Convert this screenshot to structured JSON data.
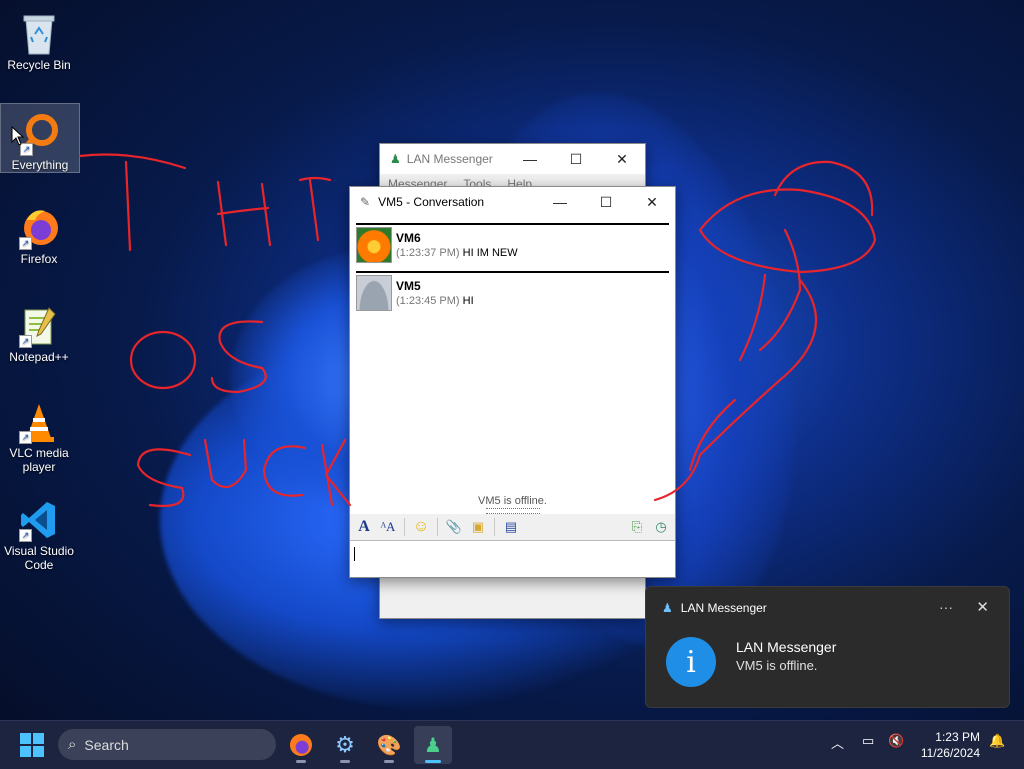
{
  "desktop": {
    "icons": [
      {
        "label": "Recycle Bin",
        "icon": "recycle-bin-icon"
      },
      {
        "label": "Everything",
        "icon": "everything-search-icon"
      },
      {
        "label": "Firefox",
        "icon": "firefox-icon"
      },
      {
        "label": "Notepad++",
        "icon": "notepadpp-icon"
      },
      {
        "label": "VLC media player",
        "icon": "vlc-icon"
      },
      {
        "label": "Visual Studio Code",
        "icon": "vscode-icon"
      }
    ]
  },
  "back_window": {
    "title": "LAN Messenger",
    "menu": [
      "Messenger",
      "Tools",
      "Help"
    ],
    "buttons": {
      "minimize": "—",
      "maximize": "☐",
      "close": "✕"
    }
  },
  "conversation_window": {
    "title": "VM5 - Conversation",
    "buttons": {
      "minimize": "—",
      "maximize": "☐",
      "close": "✕"
    },
    "messages": [
      {
        "sender": "VM6",
        "time": "(1:23:37 PM)",
        "text": "HI IM NEW",
        "avatar": "flower-avatar"
      },
      {
        "sender": "VM5",
        "time": "(1:23:45 PM)",
        "text": "HI",
        "avatar": "default-user-avatar"
      }
    ],
    "status_note": "VM5 is offline.",
    "toolbar": [
      "font-icon",
      "font-color-icon",
      "emoticon-icon",
      "send-file-icon",
      "send-folder-icon",
      "save-icon",
      "history-icon",
      "transfers-icon"
    ]
  },
  "toast": {
    "app": "LAN Messenger",
    "more": "···",
    "close": "✕",
    "title": "LAN Messenger",
    "body": "VM5 is offline.",
    "info_glyph": "i"
  },
  "scribble_color": "#e8252a",
  "taskbar": {
    "search_placeholder": "Search",
    "apps": [
      "firefox-icon",
      "settings-icon",
      "paint-icon",
      "lan-messenger-icon"
    ],
    "clock_time": "1:23 PM",
    "clock_date": "11/26/2024"
  }
}
